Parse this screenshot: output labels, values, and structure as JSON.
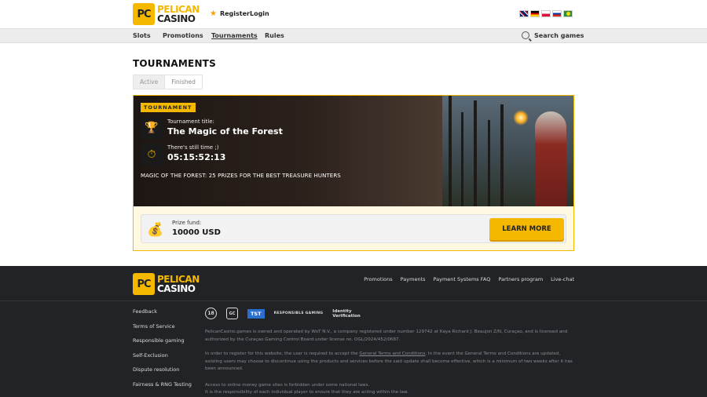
{
  "brand": {
    "badge": "PC",
    "line1": "PELICAN",
    "line2": "CASINO"
  },
  "header": {
    "register": "Register",
    "login": "Login",
    "flags": [
      "en",
      "de",
      "pl",
      "ru",
      "pt"
    ]
  },
  "nav": {
    "items": [
      "Slots",
      "Promotions",
      "Tournaments",
      "Rules"
    ],
    "active": "Tournaments",
    "search": "Search games"
  },
  "page": {
    "title": "TOURNAMENTS",
    "tabs": [
      "Active",
      "Finished"
    ]
  },
  "tournament": {
    "badge": "TOURNAMENT",
    "title_label": "Tournament title:",
    "title": "The Magic of the Forest",
    "time_label": "There's still time ;)",
    "time": "05:15:52:13",
    "description": "MAGIC OF THE FOREST: 25 PRIZES FOR THE BEST TREASURE HUNTERS",
    "prize_label": "Prize fund:",
    "prize_value": "10000 USD",
    "button": "LEARN MORE"
  },
  "footer": {
    "links": [
      "Promotions",
      "Payments",
      "Payment Systems FAQ",
      "Partners program",
      "Live-chat"
    ],
    "side": [
      "Feedback",
      "Terms of Service",
      "Responsible gaming",
      "Self-Exclusion",
      "Dispute resolution",
      "Fairness & RNG Testing"
    ],
    "badges": {
      "age": "18",
      "gc": "GC",
      "tst": "TST",
      "rg": "RESPONSIBLE GAMING",
      "id1": "Identity",
      "id2": "Verification"
    },
    "text1": "PelicanCasino.games is owned and operated by WoT N.V., a company registered under number 129742 at Kaya Richard J. Beaujon Z/N, Curaçao, and is licensed and authorized by the Curaçao Gaming Control Board under license no. OGL/2024/452/0687.",
    "text2a": "In order to register for this website, the user is required to accept the ",
    "text2link": "General Terms and Conditions",
    "text2b": ". In the event the General Terms and Conditions are updated, existing users may choose to discontinue using the products and services before the said update shall become effective, which is a minimum of two weeks after it has been announced.",
    "text3": "Access to online money game sites is forbidden under some national laws.",
    "text4": "It is the responsibility of each individual player to ensure that they are acting within the law."
  }
}
